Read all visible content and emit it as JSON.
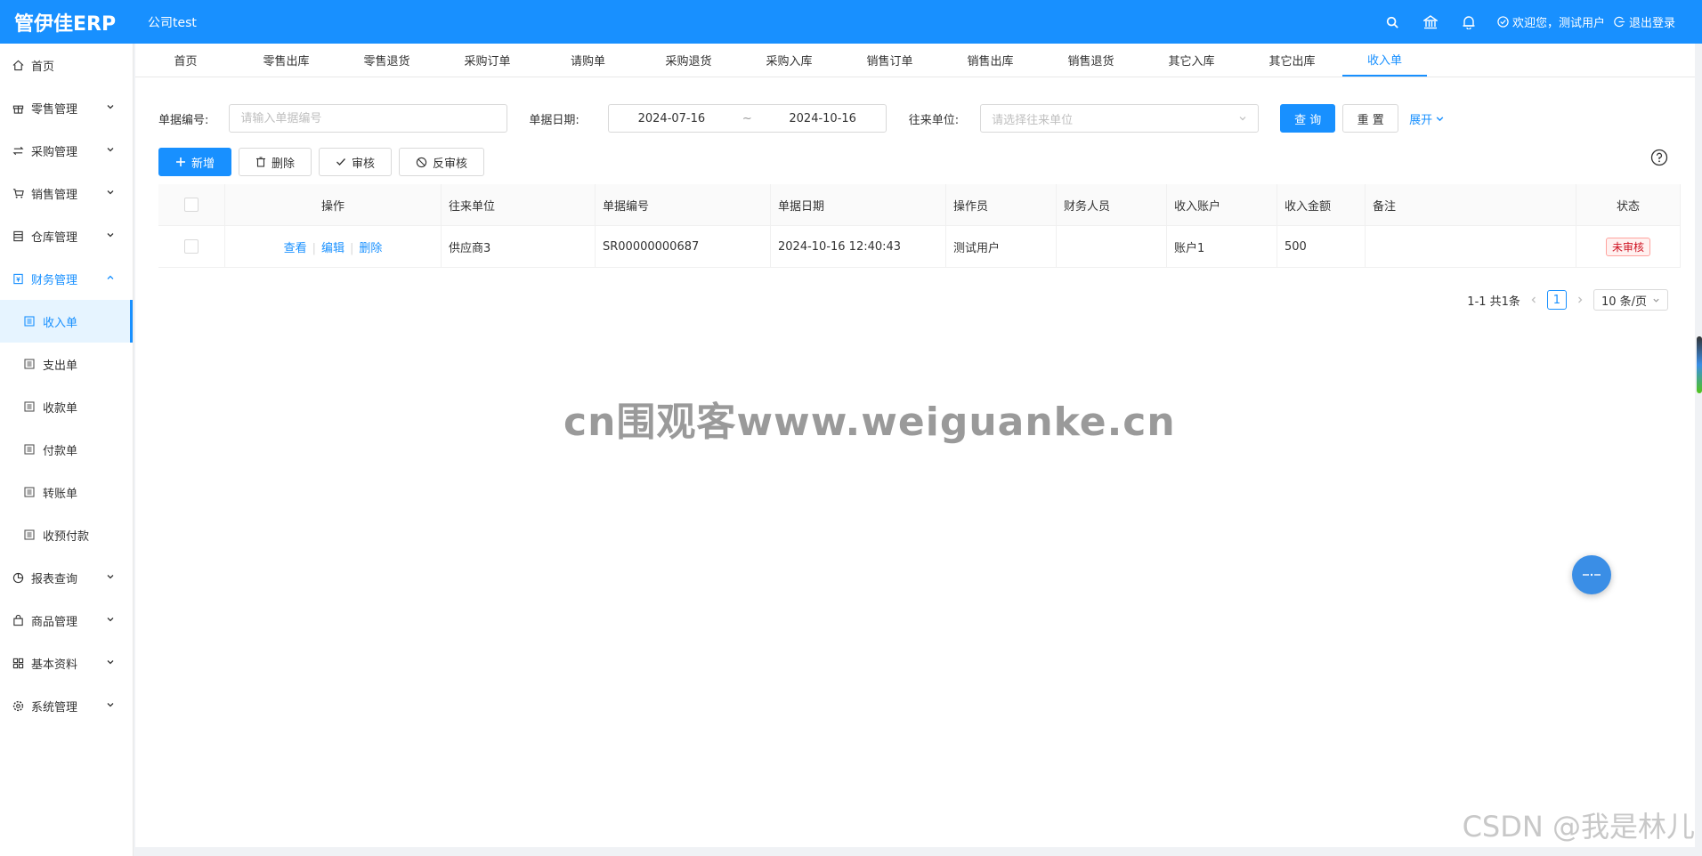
{
  "header": {
    "logo": "管伊佳ERP",
    "company": "公司test",
    "welcome": "欢迎您，测试用户",
    "logout": "退出登录"
  },
  "sidebar": {
    "items": [
      {
        "label": "首页",
        "icon": "home-icon"
      },
      {
        "label": "零售管理",
        "icon": "gift-icon"
      },
      {
        "label": "采购管理",
        "icon": "swap-icon"
      },
      {
        "label": "销售管理",
        "icon": "cart-icon"
      },
      {
        "label": "仓库管理",
        "icon": "warehouse-icon"
      },
      {
        "label": "财务管理",
        "icon": "money-icon"
      },
      {
        "label": "报表查询",
        "icon": "pie-icon"
      },
      {
        "label": "商品管理",
        "icon": "bag-icon"
      },
      {
        "label": "基本资料",
        "icon": "grid-icon"
      },
      {
        "label": "系统管理",
        "icon": "gear-icon"
      }
    ],
    "finance_sub": [
      "收入单",
      "支出单",
      "收款单",
      "付款单",
      "转账单",
      "收预付款"
    ]
  },
  "tabs": [
    "首页",
    "零售出库",
    "零售退货",
    "采购订单",
    "请购单",
    "采购退货",
    "采购入库",
    "销售订单",
    "销售出库",
    "销售退货",
    "其它入库",
    "其它出库",
    "收入单"
  ],
  "filters": {
    "bill_no_label": "单据编号:",
    "bill_no_placeholder": "请输入单据编号",
    "date_label": "单据日期:",
    "date_start": "2024-07-16",
    "date_sep": "~",
    "date_end": "2024-10-16",
    "partner_label": "往来单位:",
    "partner_placeholder": "请选择往来单位",
    "query": "查 询",
    "reset": "重 置",
    "expand": "展开"
  },
  "toolbar": {
    "add": "新增",
    "delete": "删除",
    "audit": "审核",
    "unaudit": "反审核"
  },
  "table": {
    "headers": [
      "操作",
      "往来单位",
      "单据编号",
      "单据日期",
      "操作员",
      "财务人员",
      "收入账户",
      "收入金额",
      "备注",
      "状态"
    ],
    "rows": [
      {
        "ops": [
          "查看",
          "编辑",
          "删除"
        ],
        "partner": "供应商3",
        "bill_no": "SR00000000687",
        "date": "2024-10-16 12:40:43",
        "operator": "测试用户",
        "finance": "",
        "account": "账户1",
        "amount": "500",
        "remark": "",
        "status": "未审核"
      }
    ]
  },
  "pagination": {
    "summary": "1-1 共1条",
    "page": "1",
    "size": "10 条/页"
  },
  "watermark": "cn围观客www.weiguanke.cn",
  "csdn": "CSDN @我是林儿",
  "colors": {
    "primary": "#1890ff",
    "danger": "#cf1322"
  }
}
